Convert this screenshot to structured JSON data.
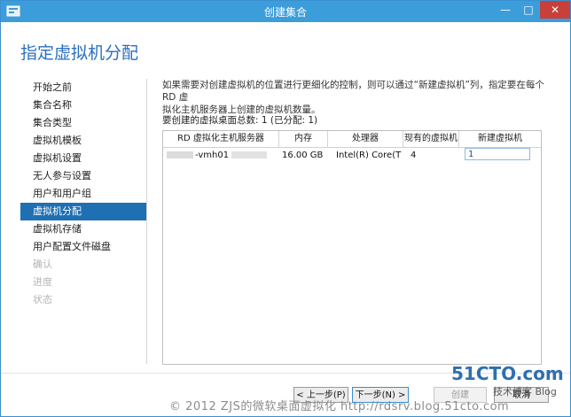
{
  "window": {
    "title": "创建集合",
    "controls": {
      "minimize": "—",
      "maximize": "□",
      "close": "✕"
    }
  },
  "page": {
    "heading": "指定虚拟机分配"
  },
  "sidebar": {
    "items": [
      {
        "label": "开始之前",
        "state": "normal"
      },
      {
        "label": "集合名称",
        "state": "normal"
      },
      {
        "label": "集合类型",
        "state": "normal"
      },
      {
        "label": "虚拟机模板",
        "state": "normal"
      },
      {
        "label": "虚拟机设置",
        "state": "normal"
      },
      {
        "label": "无人参与设置",
        "state": "normal"
      },
      {
        "label": "用户和用户组",
        "state": "normal"
      },
      {
        "label": "虚拟机分配",
        "state": "active"
      },
      {
        "label": "虚拟机存储",
        "state": "normal"
      },
      {
        "label": "用户配置文件磁盘",
        "state": "normal"
      },
      {
        "label": "确认",
        "state": "disabled"
      },
      {
        "label": "进度",
        "state": "disabled"
      },
      {
        "label": "状态",
        "state": "disabled"
      }
    ]
  },
  "main": {
    "description_line1": "如果需要对创建虚拟机的位置进行更细化的控制，则可以通过“新建虚拟机”列，指定要在每个 RD 虚",
    "description_line2": "拟化主机服务器上创建的虚拟机数量。",
    "summary": "要创建的虚拟桌面总数: 1 (已分配: 1)",
    "table": {
      "headers": [
        "RD 虚拟化主机服务器",
        "内存",
        "处理器",
        "现有的虚拟机",
        "新建虚拟机"
      ],
      "rows": [
        {
          "server": "-vmh01",
          "memory": "16.00 GB",
          "processor": "Intel(R) Core(TM",
          "existing": "4",
          "new_vms": "1"
        }
      ]
    }
  },
  "buttons": {
    "prev": "< 上一步(P)",
    "next": "下一步(N) >",
    "create": "创建",
    "cancel": "取消"
  },
  "watermark": "© 2012 ZJS的微软桌面虚拟化 http://rdsrv.blog.51cto.com",
  "logo": {
    "main": "51CTO.com",
    "sub": "技术博客 Blog"
  },
  "colors": {
    "titlebar": "#3c9ddb",
    "accent": "#1f6fb3",
    "heading": "#2a6fc0"
  }
}
